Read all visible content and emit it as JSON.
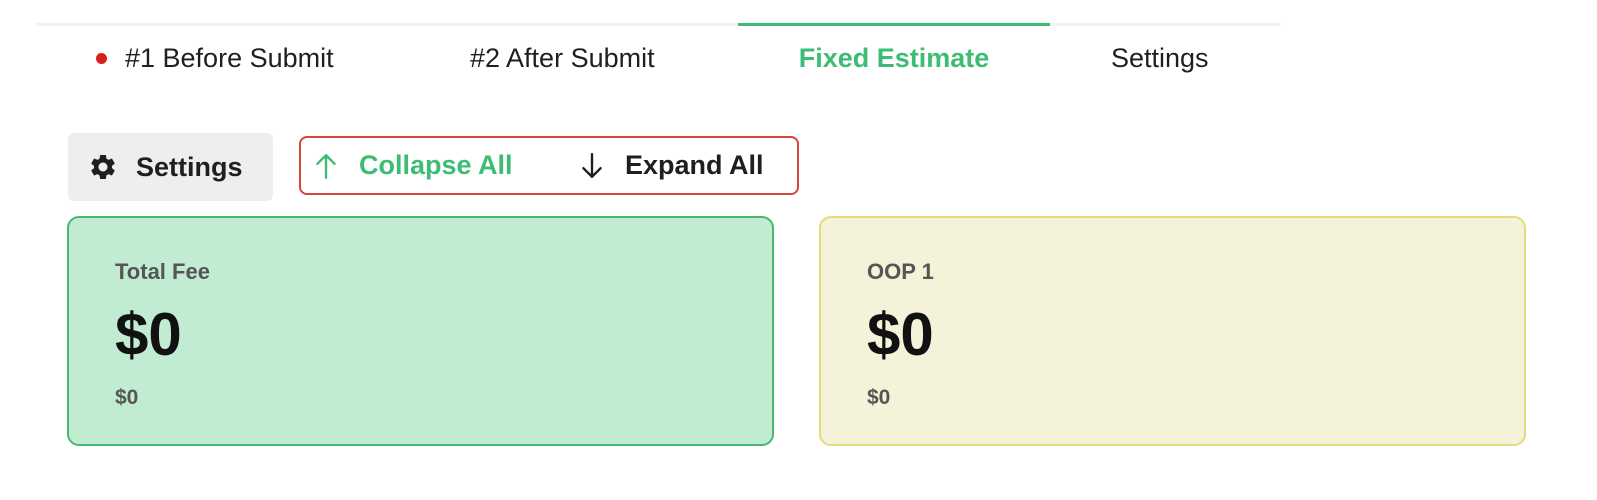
{
  "tabs": [
    {
      "label": "#1 Before Submit",
      "indicator": "red-dot",
      "active": false
    },
    {
      "label": "#2 After Submit",
      "active": false
    },
    {
      "label": "Fixed Estimate",
      "active": true
    },
    {
      "label": "Settings",
      "active": false
    }
  ],
  "toolbar": {
    "settings_label": "Settings",
    "settings_icon": "gear-icon",
    "collapse_label": "Collapse All",
    "collapse_icon": "arrow-up-icon",
    "expand_label": "Expand All",
    "expand_icon": "arrow-down-icon"
  },
  "cards": [
    {
      "label": "Total Fee",
      "amount": "$0",
      "sub_amount": "$0",
      "color": "#c2ecd2"
    },
    {
      "label": "OOP 1",
      "amount": "$0",
      "sub_amount": "$0",
      "color": "#f4f2d9"
    }
  ],
  "colors": {
    "accent": "#3dbd73",
    "indicator": "#d6201e",
    "highlight_border": "#d9453c"
  }
}
